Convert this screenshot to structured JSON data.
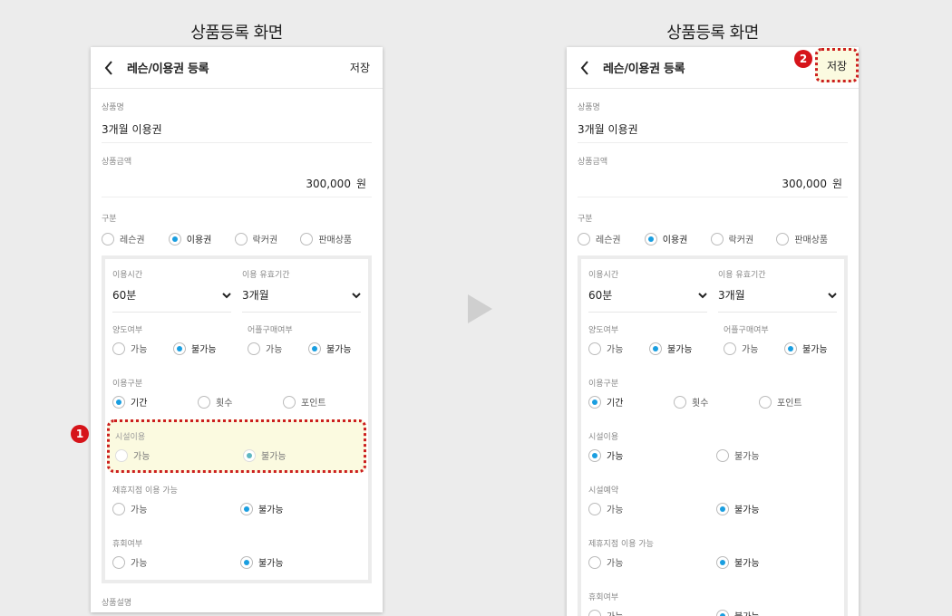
{
  "screens": [
    {
      "caption": "상품등록 화면",
      "appbar": {
        "title": "레슨/이용권 등록",
        "save_label": "저장"
      },
      "badge": "1",
      "product_name": {
        "label": "상품명",
        "value": "3개월 이용권"
      },
      "price": {
        "label": "상품금액",
        "value": "300,000",
        "unit": "원"
      },
      "category": {
        "label": "구분",
        "options": [
          "레슨권",
          "이용권",
          "락커권",
          "판매상품"
        ],
        "selected": 1
      },
      "use_time": {
        "label": "이용시간",
        "value": "60분"
      },
      "validity": {
        "label": "이용 유효기간",
        "value": "3개월"
      },
      "groups": [
        {
          "row": [
            {
              "label": "양도여부",
              "options": [
                "가능",
                "불가능"
              ],
              "selected": 1
            },
            {
              "label": "어플구매여부",
              "options": [
                "가능",
                "불가능"
              ],
              "selected": 1
            }
          ]
        },
        {
          "label": "이용구분",
          "options": [
            "기간",
            "횟수",
            "포인트"
          ],
          "selected": 0
        },
        {
          "label": "시설이용",
          "options": [
            "가능",
            "불가능"
          ],
          "selected": 1,
          "highlight": true
        },
        {
          "label": "제휴지점 이용 가능",
          "options": [
            "가능",
            "불가능"
          ],
          "selected": 1
        },
        {
          "label": "휴회여부",
          "options": [
            "가능",
            "불가능"
          ],
          "selected": 1
        }
      ],
      "description_label": "상품설명"
    },
    {
      "caption": "상품등록 화면",
      "appbar": {
        "title": "레슨/이용권 등록",
        "save_label": "저장"
      },
      "badge": "2",
      "product_name": {
        "label": "상품명",
        "value": "3개월 이용권"
      },
      "price": {
        "label": "상품금액",
        "value": "300,000",
        "unit": "원"
      },
      "category": {
        "label": "구분",
        "options": [
          "레슨권",
          "이용권",
          "락커권",
          "판매상품"
        ],
        "selected": 1
      },
      "use_time": {
        "label": "이용시간",
        "value": "60분"
      },
      "validity": {
        "label": "이용 유효기간",
        "value": "3개월"
      },
      "groups": [
        {
          "row": [
            {
              "label": "양도여부",
              "options": [
                "가능",
                "불가능"
              ],
              "selected": 1
            },
            {
              "label": "어플구매여부",
              "options": [
                "가능",
                "불가능"
              ],
              "selected": 1
            }
          ]
        },
        {
          "label": "이용구분",
          "options": [
            "기간",
            "횟수",
            "포인트"
          ],
          "selected": 0
        },
        {
          "label": "시설이용",
          "options": [
            "가능",
            "불가능"
          ],
          "selected": 0
        },
        {
          "label": "시설예약",
          "options": [
            "가능",
            "불가능"
          ],
          "selected": 1
        },
        {
          "label": "제휴지점 이용 가능",
          "options": [
            "가능",
            "불가능"
          ],
          "selected": 1
        },
        {
          "label": "휴회여부",
          "options": [
            "가능",
            "불가능"
          ],
          "selected": 1
        }
      ]
    }
  ],
  "colors": {
    "radio_selected": "#1a9ee0",
    "highlight_bg": "#fbfae0",
    "highlight_border": "#cc1e1e",
    "badge": "#d6141a"
  },
  "icons": {
    "back": "chevron-left-icon",
    "dropdown": "chevron-down-icon",
    "next": "play-arrow-icon"
  }
}
